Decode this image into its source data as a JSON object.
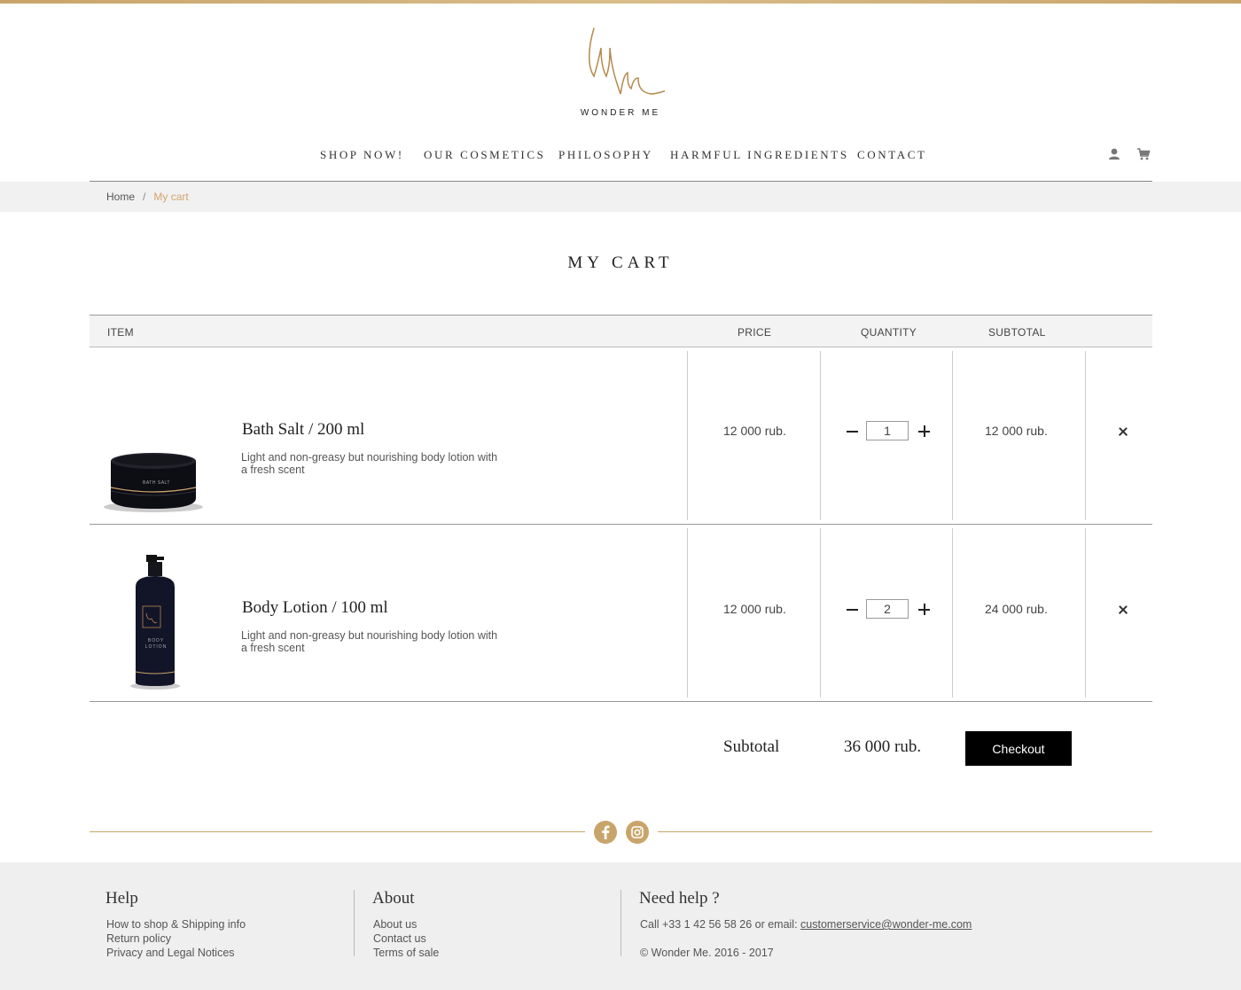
{
  "brand": {
    "name": "WONDER ME",
    "accent": "#c9a46a"
  },
  "nav": {
    "items": [
      "SHOP NOW!",
      "OUR COSMETICS",
      "PHILOSOPHY",
      "HARMFUL INGREDIENTS",
      "CONTACT"
    ],
    "icons": [
      "user-icon",
      "cart-icon"
    ]
  },
  "breadcrumb": {
    "home": "Home",
    "separator": "/",
    "current": "My cart"
  },
  "page_title": "MY CART",
  "table": {
    "headers": {
      "item": "ITEM",
      "price": "PRICE",
      "quantity": "QUANTITY",
      "subtotal": "SUBTOTAL"
    },
    "rows": [
      {
        "name": "Bath Salt / 200 ml",
        "description": "Light and non-greasy but nourishing body lotion with a fresh scent",
        "jar_label": "BATH SALT",
        "price": "12 000 rub.",
        "quantity": "1",
        "subtotal": "12 000 rub."
      },
      {
        "name": "Body Lotion / 100 ml",
        "description": "Light and non-greasy but nourishing body lotion with a fresh scent",
        "bottle_label": "BODY LOTION",
        "price": "12 000 rub.",
        "quantity": "2",
        "subtotal": "24 000 rub."
      }
    ]
  },
  "summary": {
    "label": "Subtotal",
    "value": "36 000 rub.",
    "checkout_label": "Checkout"
  },
  "social": [
    "facebook-icon",
    "instagram-icon"
  ],
  "footer": {
    "help": {
      "title": "Help",
      "links": [
        "How to shop & Shipping info",
        "Return policy",
        "Privacy and Legal Notices"
      ]
    },
    "about": {
      "title": "About",
      "links": [
        "About us",
        "Contact us",
        "Terms of sale"
      ]
    },
    "contact": {
      "title": "Need help ?",
      "call_text": "Call +33 1 42 56 58 26 or email: ",
      "email": "customerservice@wonder-me.com",
      "copyright": "© Wonder Me. 2016 - 2017"
    }
  }
}
